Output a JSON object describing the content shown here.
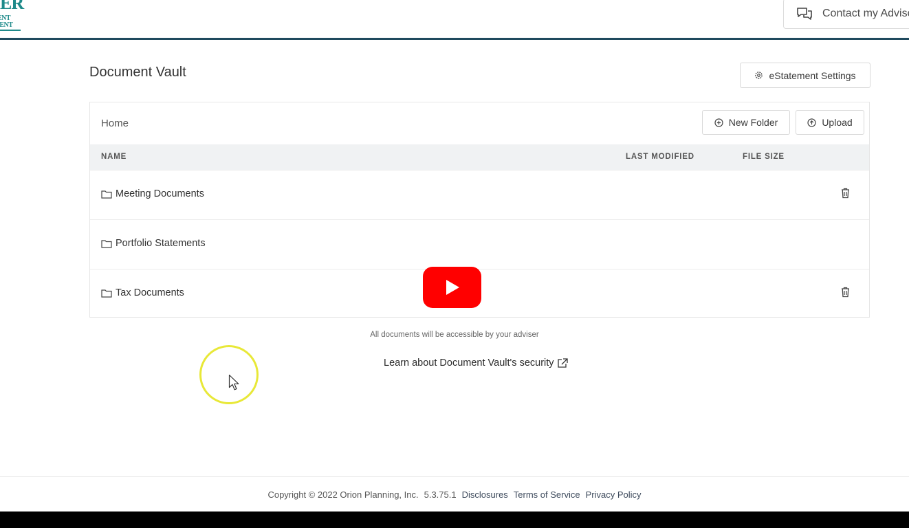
{
  "header": {
    "logo_line1": "ER",
    "logo_line2": "ENT",
    "logo_line3": "IENT",
    "contact_label": "Contact my Advisor"
  },
  "page": {
    "title": "Document Vault",
    "estatement_label": "eStatement Settings"
  },
  "vault": {
    "breadcrumb": "Home",
    "new_folder_label": "New Folder",
    "upload_label": "Upload",
    "columns": [
      "NAME",
      "LAST MODIFIED",
      "FILE SIZE"
    ],
    "rows": [
      {
        "name": "Meeting Documents",
        "deletable": true
      },
      {
        "name": "Portfolio Statements",
        "deletable": false
      },
      {
        "name": "Tax Documents",
        "deletable": true
      }
    ],
    "note": "All documents will be accessible by your adviser",
    "security_link": "Learn about Document Vault's security"
  },
  "footer": {
    "copyright": "Copyright © 2022 Orion Planning, Inc.",
    "version": "5.3.75.1",
    "links": [
      "Disclosures",
      "Terms of Service",
      "Privacy Policy"
    ]
  },
  "colors": {
    "accent_line": "#1f4a5e",
    "logo": "#1e8a8a",
    "play_button": "#ff0000",
    "cursor_ring": "#e8e838"
  },
  "icons": [
    "chat-icon",
    "gear-icon",
    "plus-circle-icon",
    "upload-circle-icon",
    "folder-icon",
    "trash-icon",
    "external-link-icon",
    "play-icon",
    "cursor-icon"
  ]
}
